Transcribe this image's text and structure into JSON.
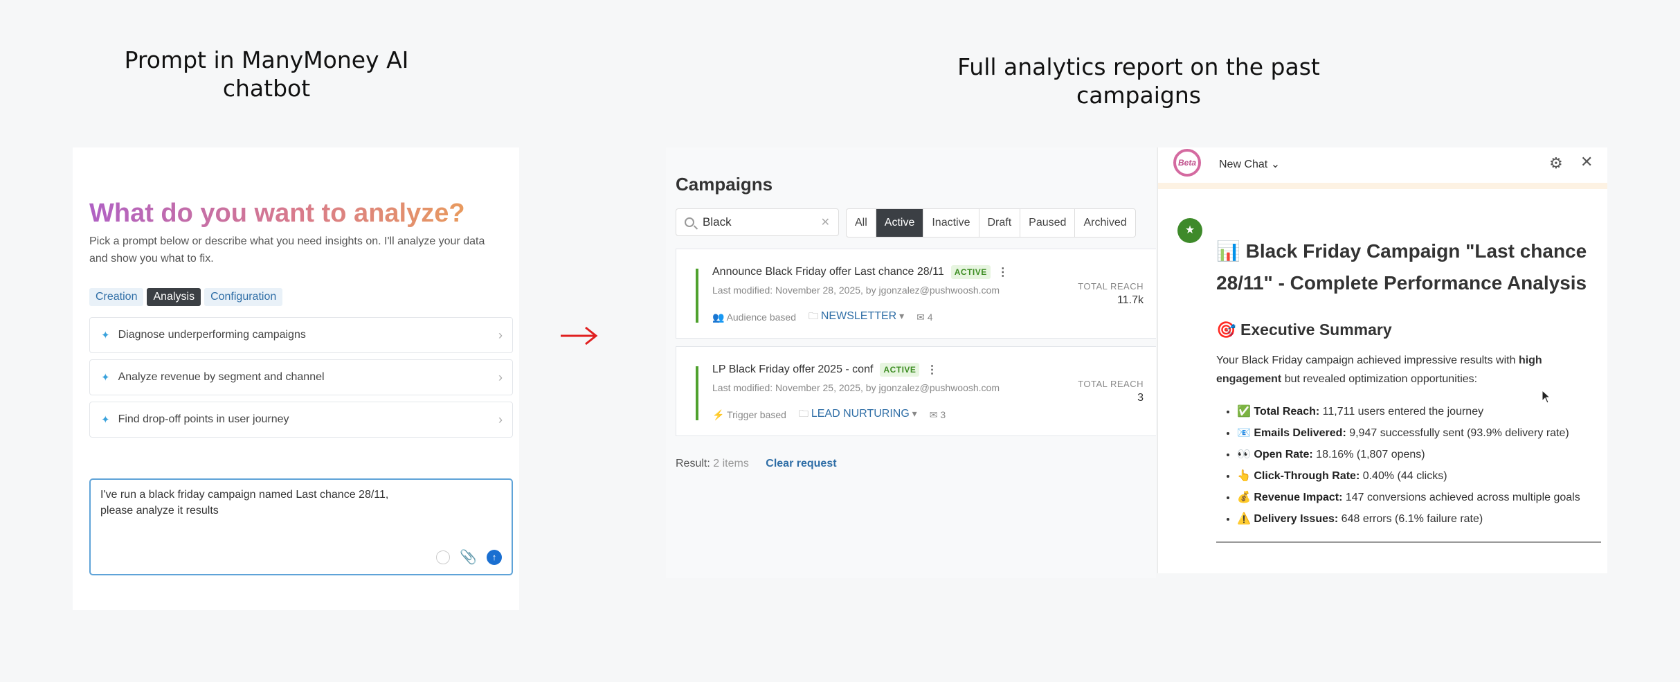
{
  "captions": {
    "left": "Prompt in ManyMoney AI chatbot",
    "right": "Full analytics report on the past campaigns"
  },
  "analyze_panel": {
    "title": "What do you want to analyze?",
    "subtitle": "Pick a prompt below or describe what you need insights on. I'll analyze your data and show you what to fix.",
    "tabs": [
      "Creation",
      "Analysis",
      "Configuration"
    ],
    "active_tab": "Analysis",
    "prompts": [
      "Diagnose underperforming campaigns",
      "Analyze revenue by segment and channel",
      "Find drop-off points in user journey"
    ],
    "chat_input": "I've run a black friday campaign named Last chance 28/11,\nplease analyze it results"
  },
  "campaigns": {
    "title": "Campaigns",
    "search_value": "Black",
    "filters": [
      "All",
      "Active",
      "Inactive",
      "Draft",
      "Paused",
      "Archived"
    ],
    "active_filter": "Active",
    "items": [
      {
        "name": "Announce Black Friday offer Last chance 28/11",
        "status": "ACTIVE",
        "modified": "Last modified: November 28, 2025, by jgonzalez@pushwoosh.com",
        "type": "Audience based",
        "folder": "NEWSLETTER",
        "messages": "4",
        "reach_label": "TOTAL REACH",
        "reach": "11.7k"
      },
      {
        "name": "LP Black Friday offer 2025 - conf",
        "status": "ACTIVE",
        "modified": "Last modified: November 25, 2025, by jgonzalez@pushwoosh.com",
        "type": "Trigger based",
        "folder": "LEAD NURTURING",
        "messages": "3",
        "reach_label": "TOTAL REACH",
        "reach": "3"
      }
    ],
    "result_label": "Result:",
    "result_count": "2 items",
    "clear": "Clear request"
  },
  "chat": {
    "beta": "Beta",
    "new_chat": "New Chat",
    "report_title": "📊 Black Friday Campaign \"Last chance 28/11\" - Complete Performance Analysis",
    "summary_heading": "🎯 Executive Summary",
    "intro_prefix": "Your Black Friday campaign achieved impressive results with ",
    "intro_bold": "high engagement",
    "intro_suffix": " but revealed optimization opportunities:",
    "bullets": [
      {
        "icon": "✅",
        "label": "Total Reach:",
        "text": " 11,711 users entered the journey"
      },
      {
        "icon": "📧",
        "label": "Emails Delivered:",
        "text": " 9,947 successfully sent (93.9% delivery rate)"
      },
      {
        "icon": "👀",
        "label": "Open Rate:",
        "text": " 18.16% (1,807 opens)"
      },
      {
        "icon": "👆",
        "label": "Click-Through Rate:",
        "text": " 0.40% (44 clicks)"
      },
      {
        "icon": "💰",
        "label": "Revenue Impact:",
        "text": " 147 conversions achieved across multiple goals"
      },
      {
        "icon": "⚠️",
        "label": "Delivery Issues:",
        "text": " 648 errors (6.1% failure rate)"
      }
    ]
  },
  "colors": {
    "accent_blue": "#2f6ea6",
    "active_green": "#4fa12e",
    "arrow_red": "#e02020"
  }
}
